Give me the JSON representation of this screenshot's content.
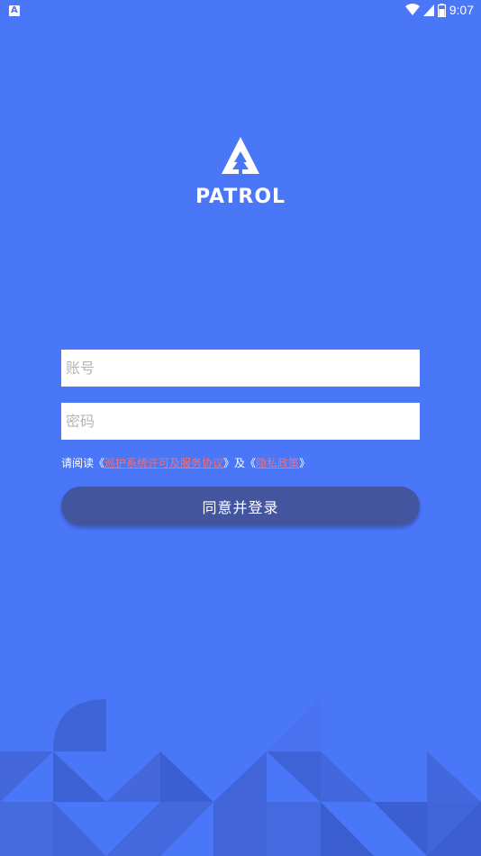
{
  "status_bar": {
    "left_icon": "A",
    "time": "9:07",
    "icons": [
      "wifi-icon",
      "signal-icon",
      "battery-icon"
    ]
  },
  "logo": {
    "icon": "tree-triangle-icon",
    "text": "PATROL"
  },
  "form": {
    "account_placeholder": "账号",
    "password_placeholder": "密码"
  },
  "agreement": {
    "prefix": "请阅读《",
    "terms_link": "巡护系统许可及服务协议",
    "middle": "》及《",
    "privacy_link": "隐私政策",
    "suffix": "》"
  },
  "login_button": "同意并登录",
  "colors": {
    "background": "#4a76f8",
    "button": "#4455a0",
    "link": "#f0707a"
  }
}
